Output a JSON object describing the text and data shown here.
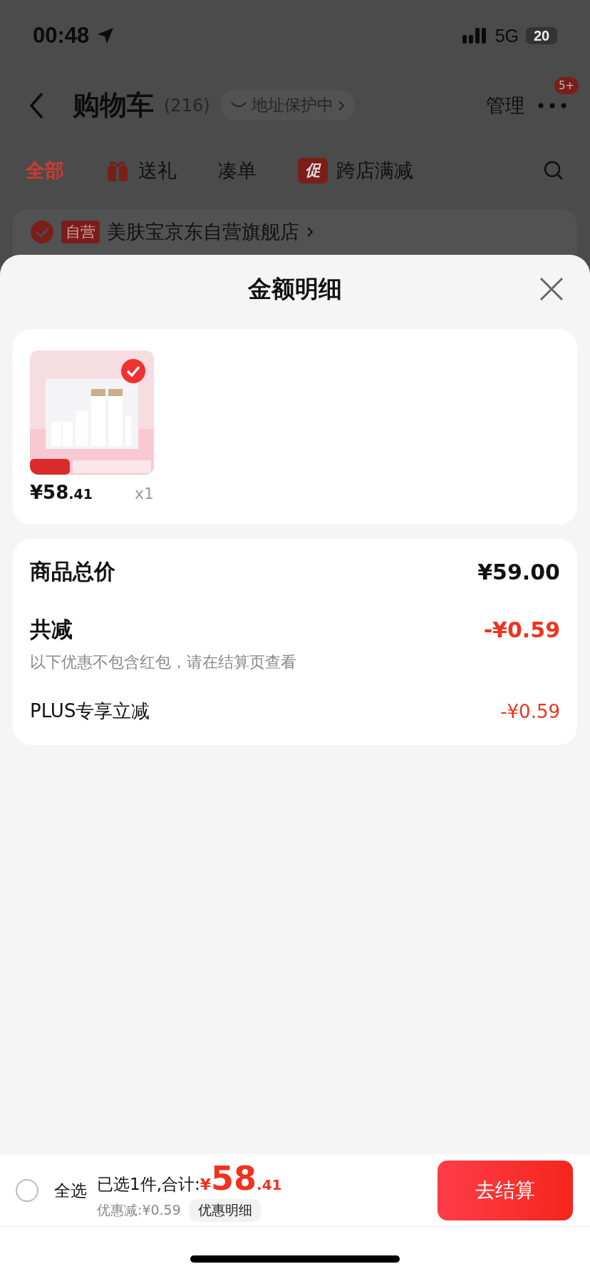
{
  "status_bar": {
    "time": "00:48",
    "network": "5G",
    "battery": "20"
  },
  "header": {
    "title": "购物车",
    "count": "(216)",
    "address_badge": "地址保护中",
    "manage": "管理",
    "more_badge": "5+"
  },
  "tabs": [
    {
      "label": "全部",
      "selected": true,
      "kind": "plain"
    },
    {
      "label": "送礼",
      "selected": false,
      "kind": "gift"
    },
    {
      "label": "凑单",
      "selected": false,
      "kind": "plain"
    },
    {
      "label": "跨店满减",
      "selected": false,
      "kind": "promo",
      "badge": "促"
    }
  ],
  "store": {
    "checked": true,
    "tag": "自营",
    "name": "美肤宝京东自营旗舰店"
  },
  "sheet": {
    "title": "金额明细",
    "items": [
      {
        "kind": "picture",
        "selected": true,
        "price_main": "¥58",
        "price_decimal": ".41",
        "quantity": "x1"
      }
    ],
    "summary": {
      "total_label": "商品总价",
      "total_value": "¥59.00",
      "discount_label": "共减",
      "discount_value": "-¥0.59",
      "note": "以下优惠不包含红包，请在结算页查看",
      "details": [
        {
          "label": "PLUS专享立减",
          "value": "-¥0.59"
        }
      ]
    }
  },
  "footer": {
    "select_all": {
      "label": "全选",
      "checked": false
    },
    "selected_text": "已选1件,合计:",
    "currency": "¥",
    "total_main": "58",
    "total_decimal": ".41",
    "discount_text": "优惠减:¥0.59",
    "details_button": "优惠明细",
    "checkout_button": "去结算"
  }
}
